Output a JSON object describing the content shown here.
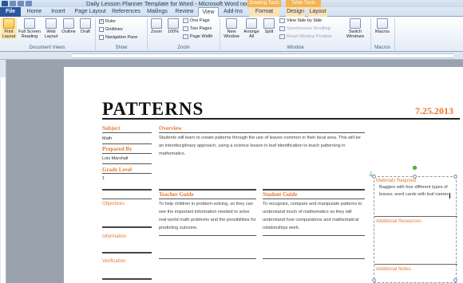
{
  "window": {
    "title": "Daily Lesson Planner Template for Word - Microsoft Word non-com...",
    "context_tabs": [
      "Drawing Tools",
      "Table Tools"
    ]
  },
  "tabs": [
    "File",
    "Home",
    "Insert",
    "Page Layout",
    "References",
    "Mailings",
    "Review",
    "View",
    "Add-Ins",
    "Format",
    "Design",
    "Layout"
  ],
  "active_tab": "View",
  "ribbon": {
    "document_views": {
      "label": "Document Views",
      "buttons": [
        "Print Layout",
        "Full Screen Reading",
        "Web Layout",
        "Outline",
        "Draft"
      ]
    },
    "show": {
      "label": "Show",
      "items": [
        {
          "label": "Ruler",
          "checked": true
        },
        {
          "label": "Gridlines",
          "checked": false
        },
        {
          "label": "Navigation Pane",
          "checked": false
        }
      ]
    },
    "zoom": {
      "label": "Zoom",
      "zoom_btn": "Zoom",
      "pct_btn": "100%",
      "one_page": "One Page",
      "two_pages": "Two Pages",
      "page_width": "Page Width"
    },
    "window": {
      "label": "Window",
      "new_window": "New Window",
      "arrange_all": "Arrange All",
      "split": "Split",
      "side_by_side": "View Side by Side",
      "sync_scroll": "Synchronous Scrolling",
      "reset_pos": "Reset Window Position",
      "switch_windows": "Switch Windows"
    },
    "macros": {
      "label": "Macros",
      "button": "Macros"
    }
  },
  "doc": {
    "title": "PATTERNS",
    "date": "7.25.2013",
    "subject_label": "Subject",
    "subject_value": "Math",
    "prepared_label": "Prepared By",
    "prepared_value": "Lois Marshall",
    "grade_label": "Grade Level",
    "grade_value": "1",
    "overview_label": "Overview",
    "overview_text": "Students will learn to create patterns through the use of leaves common in their local area. This will be an interdisciplinary approach, using a science lesson in leaf identification to teach patterning in mathematics.",
    "objectives_label": "Objectives",
    "information_label": "Information",
    "verification_label": "Verification",
    "teacher_guide_label": "Teacher Guide",
    "teacher_guide_text": "To help children in problem-solving, so they can see the important information needed to solve real-world math problems and the possibilities for predicting outcome.",
    "student_guide_label": "Student Guide",
    "student_guide_text": "To recognize, compare and manipulate patterns to understand much of mathematics so they will understand how computations and mathematical relationships work.",
    "materials_label": "Materials Required",
    "materials_text": "Baggies with four different types of leaves; word cards with leaf names",
    "resources_label": "Additional Resources",
    "notes_label": "Additional Notes"
  }
}
